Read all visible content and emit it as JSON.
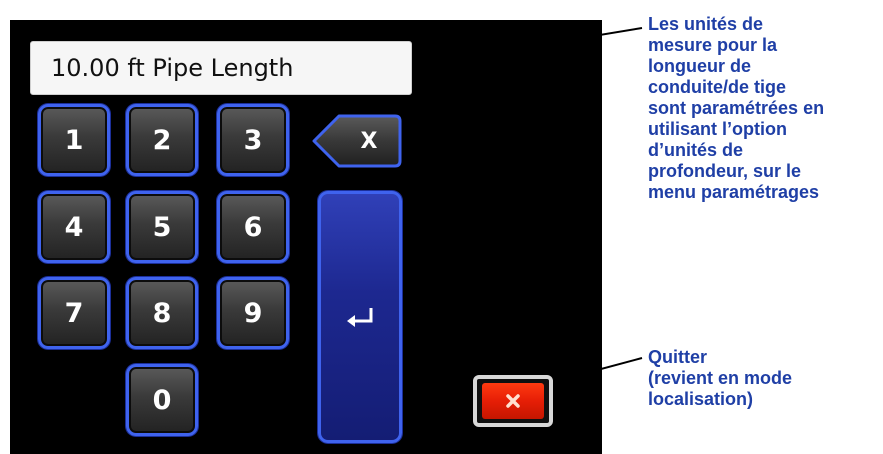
{
  "display": {
    "value": "10.00 ft Pipe Length"
  },
  "keypad": {
    "keys": [
      "1",
      "2",
      "3",
      "4",
      "5",
      "6",
      "7",
      "8",
      "9",
      "0"
    ],
    "backspace_label": "X",
    "enter_icon": "enter-return-icon"
  },
  "quit_button": {
    "icon": "close-x-icon"
  },
  "annotations": {
    "units": "Les unités de\nmesure pour la\nlongueur de\nconduite/de tige\nsont paramétrées en\nutilisant l’option\nd’unités de\nprofondeur, sur le\nmenu paramétrages",
    "quit": "Quitter\n(revient en mode\nlocalisation)"
  },
  "colors": {
    "screen_bg": "#000000",
    "key_border": "#3f63ee",
    "enter_fill": "#1d2890",
    "quit_fill": "#e61e06",
    "annotation_text": "#1f3fa6"
  }
}
